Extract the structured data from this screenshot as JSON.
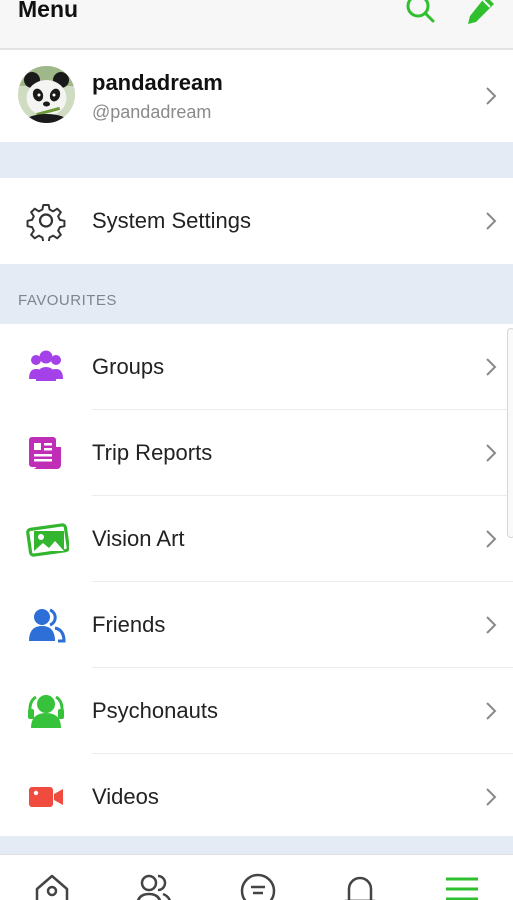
{
  "header": {
    "title": "Menu"
  },
  "profile": {
    "name": "pandadream",
    "handle": "@pandadream"
  },
  "settings": {
    "label": "System Settings"
  },
  "favourites": {
    "section_title": "FAVOURITES",
    "items": [
      {
        "label": "Groups",
        "icon": "groups-icon",
        "color": "#a441e8"
      },
      {
        "label": "Trip Reports",
        "icon": "trip-reports-icon",
        "color": "#c02db6"
      },
      {
        "label": "Vision Art",
        "icon": "vision-art-icon",
        "color": "#33b52f"
      },
      {
        "label": "Friends",
        "icon": "friends-icon",
        "color": "#2d6fd6"
      },
      {
        "label": "Psychonauts",
        "icon": "psychonauts-icon",
        "color": "#36c23a"
      },
      {
        "label": "Videos",
        "icon": "videos-icon",
        "color": "#ef4b3f"
      }
    ]
  },
  "colors": {
    "accent": "#2fbf2f",
    "section_bg": "#e4ebf4"
  }
}
